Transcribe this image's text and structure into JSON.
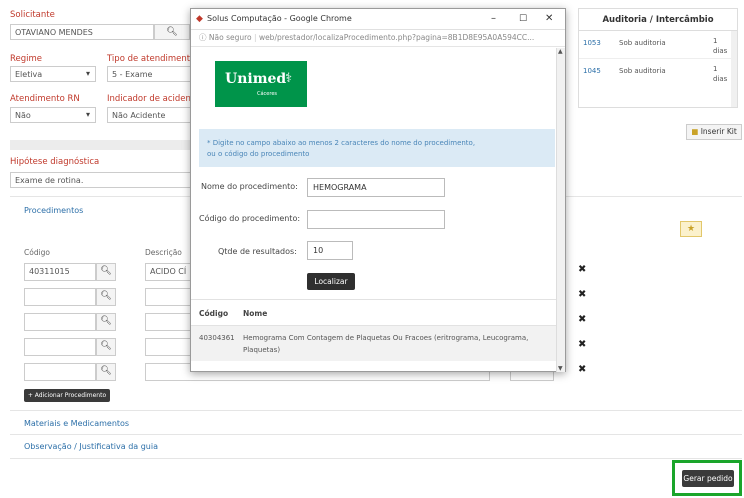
{
  "form": {
    "solicitante_label": "Solicitante",
    "solicitante_value": "OTAVIANO MENDES",
    "regime_label": "Regime",
    "regime_value": "Eletiva",
    "tipo_atendimento_label": "Tipo de atendimento",
    "tipo_atendimento_value": "5 - Exame",
    "atendimento_rn_label": "Atendimento RN",
    "atendimento_rn_value": "Não",
    "indicador_acidente_label": "Indicador de acidente",
    "indicador_acidente_value": "Não Acidente",
    "hipotese_label": "Hipótese diagnóstica",
    "hipotese_value": "Exame de rotina.",
    "inserir_kit_label": "Inserir Kit"
  },
  "auditoria": {
    "title": "Auditoria / Intercâmbio",
    "rows": [
      {
        "code": "1053",
        "status": "Sob auditoria",
        "days": "1",
        "unit": "dias"
      },
      {
        "code": "1045",
        "status": "Sob auditoria",
        "days": "1",
        "unit": "dias"
      }
    ]
  },
  "procedimentos": {
    "section_title": "Procedimentos",
    "codigo_header": "Código",
    "descricao_header": "Descrição",
    "first_code": "40311015",
    "first_desc": "ACIDO CÍ",
    "add_button": "+ Adicionar Procedimento"
  },
  "sections": {
    "materiais": "Materiais e Medicamentos",
    "observacao": "Observação / Justificativa da guia"
  },
  "footer": {
    "gerar_pedido": "Gerar pedido"
  },
  "popup": {
    "window_title": "Solus Computação - Google Chrome",
    "url_secure": "Não seguro",
    "url": "web/prestador/localizaProcedimento.php?pagina=8B1D8E95A0A594CC...",
    "logo_text": "Unimed",
    "logo_sub": "Cáceres",
    "info_line1": "* Digite no campo abaixo ao menos 2 caracteres do nome do procedimento,",
    "info_line2": "ou o código do procedimento",
    "nome_label": "Nome do procedimento:",
    "nome_value": "HEMOGRAMA",
    "codigo_label": "Código do procedimento:",
    "codigo_value": "",
    "qtde_label": "Qtde de resultados:",
    "qtde_value": "10",
    "localizar": "Localizar",
    "table_codigo": "Código",
    "table_nome": "Nome",
    "result_code": "40304361",
    "result_name_1": "Hemograma Com Contagem de Plaquetas Ou Fracoes (eritrograma, Leucograma,",
    "result_name_2": "Plaquetas)"
  },
  "colors": {
    "label_red": "#c0392b",
    "link_blue": "#2c6fa8",
    "unimed_green": "#00944a",
    "highlight_green": "#1aa52a",
    "dark_button": "#3a3a3a"
  }
}
